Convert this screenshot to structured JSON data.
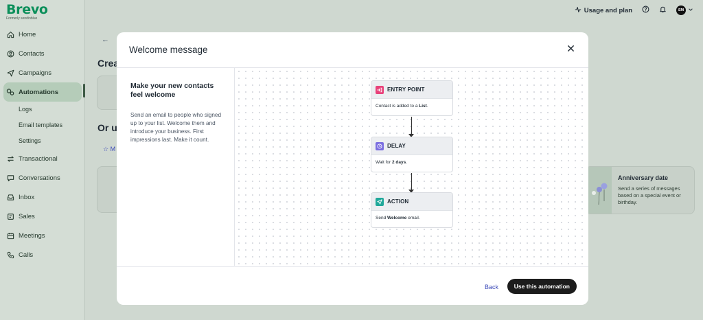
{
  "app": {
    "logo_text": "Brevo",
    "logo_sub": "Formerly sendinblue"
  },
  "sidebar": {
    "items": [
      {
        "label": "Home",
        "icon": "home-icon"
      },
      {
        "label": "Contacts",
        "icon": "contacts-icon"
      },
      {
        "label": "Campaigns",
        "icon": "send-icon"
      },
      {
        "label": "Automations",
        "icon": "automation-icon",
        "active": true
      },
      {
        "label": "Transactional",
        "icon": "transfer-icon"
      },
      {
        "label": "Conversations",
        "icon": "chat-icon"
      },
      {
        "label": "Inbox",
        "icon": "inbox-icon"
      },
      {
        "label": "Sales",
        "icon": "sales-icon"
      },
      {
        "label": "Meetings",
        "icon": "calendar-icon"
      },
      {
        "label": "Calls",
        "icon": "phone-icon"
      }
    ],
    "subitems": [
      "Logs",
      "Email templates",
      "Settings"
    ]
  },
  "topbar": {
    "usage_label": "Usage and plan",
    "avatar_initials": "SM"
  },
  "background": {
    "back_arrow": "←",
    "heading_1": "Crea",
    "heading_2": "Or us",
    "tab_label": "M",
    "card_right_title": "Anniversary date",
    "card_right_desc": "Send a series of messages based on a special event or birthday."
  },
  "modal": {
    "title": "Welcome message",
    "left_title": "Make your new contacts feel welcome",
    "left_description": "Send an email to people who signed up to your list. Welcome them and introduce your business. First impressions last. Make it count.",
    "nodes": {
      "entry": {
        "label": "ENTRY POINT",
        "text_prefix": "Contact is added to a ",
        "text_bold": "List",
        "text_suffix": ".",
        "color": "#e8417a"
      },
      "delay": {
        "label": "DELAY",
        "text_prefix": "Wait for ",
        "text_bold": "2 days",
        "text_suffix": ".",
        "color": "#7b6ee0"
      },
      "action": {
        "label": "ACTION",
        "text_prefix": "Send ",
        "text_bold": "Welcome",
        "text_suffix": " email.",
        "color": "#20a89a"
      }
    },
    "footer": {
      "back_label": "Back",
      "primary_label": "Use this automation"
    }
  },
  "colors": {
    "brand_green": "#0b8f5a",
    "link_blue": "#3b49b8",
    "primary_button": "#1c1c1c",
    "overlay_tint": "#cfd8d0"
  }
}
